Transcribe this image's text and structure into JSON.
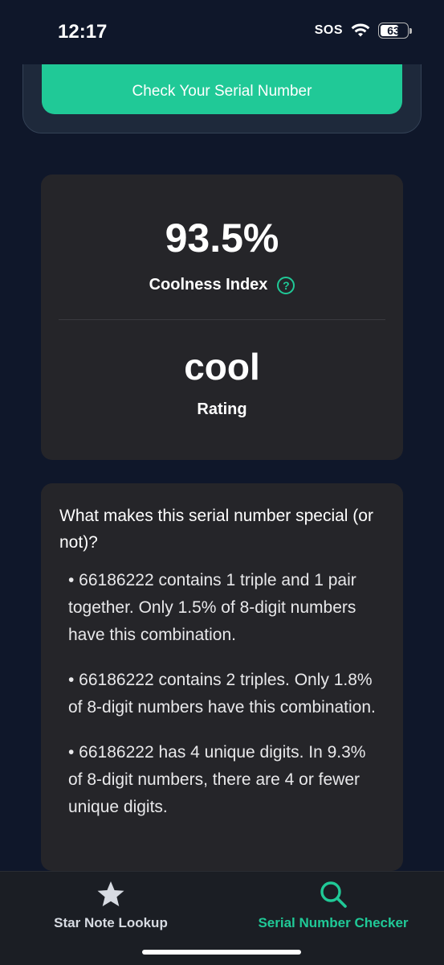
{
  "status_bar": {
    "time": "12:17",
    "sos": "SOS",
    "battery": "63",
    "icons": [
      "wifi-icon",
      "battery-icon"
    ]
  },
  "form": {
    "check_button_label": "Check Your Serial Number"
  },
  "score": {
    "coolness_value": "93.5%",
    "coolness_label": "Coolness Index",
    "help_glyph": "?",
    "rating_value": "cool",
    "rating_label": "Rating"
  },
  "details": {
    "heading": "What makes this serial number special (or not)?",
    "facts": [
      "• 66186222 contains 1 triple and 1 pair together. Only 1.5% of 8-digit numbers have this combination.",
      "• 66186222 contains 2 triples. Only 1.8% of 8-digit numbers have this combination.",
      "• 66186222 has 4 unique digits. In 9.3% of 8-digit numbers, there are 4 or fewer unique digits."
    ]
  },
  "tabs": [
    {
      "label": "Star Note Lookup",
      "icon": "star-icon",
      "active": false
    },
    {
      "label": "Serial Number Checker",
      "icon": "search-icon",
      "active": true
    }
  ],
  "colors": {
    "background": "#0f172a",
    "accent": "#20c997",
    "card": "#252529",
    "tab_bar": "#1b1e24"
  }
}
